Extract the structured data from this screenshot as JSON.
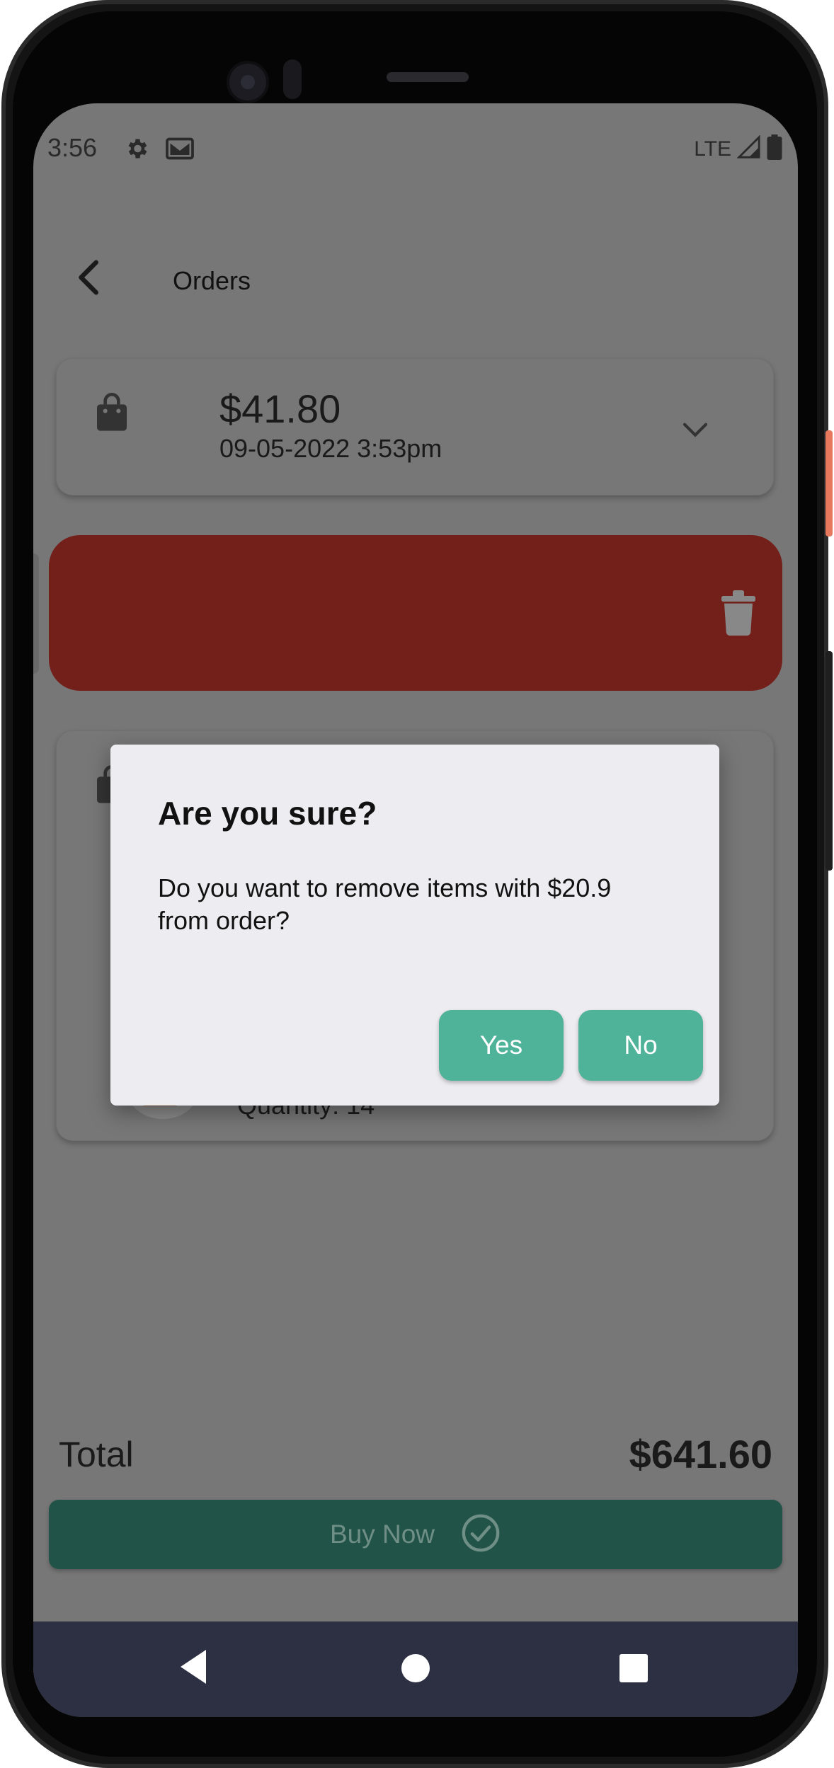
{
  "status_bar": {
    "time": "3:56",
    "network": "LTE",
    "icons": [
      "gear-icon",
      "mail-icon",
      "signal-icon",
      "battery-icon"
    ]
  },
  "header": {
    "title": "Orders"
  },
  "orders": [
    {
      "amount": "$41.80",
      "date": "09-05-2022 3:53pm"
    }
  ],
  "order_detail": {
    "quantity": "Quantity: 14"
  },
  "dialog": {
    "title": "Are you sure?",
    "message": "Do you want to remove items with $20.9 from order?",
    "yes_label": "Yes",
    "no_label": "No"
  },
  "footer": {
    "total_label": "Total",
    "total_value": "$641.60",
    "buy_label": "Buy Now"
  },
  "colors": {
    "accent": "#4fb399",
    "delete": "#731f1a",
    "buy_button": "#225348",
    "nav_bar": "#2d3042"
  }
}
